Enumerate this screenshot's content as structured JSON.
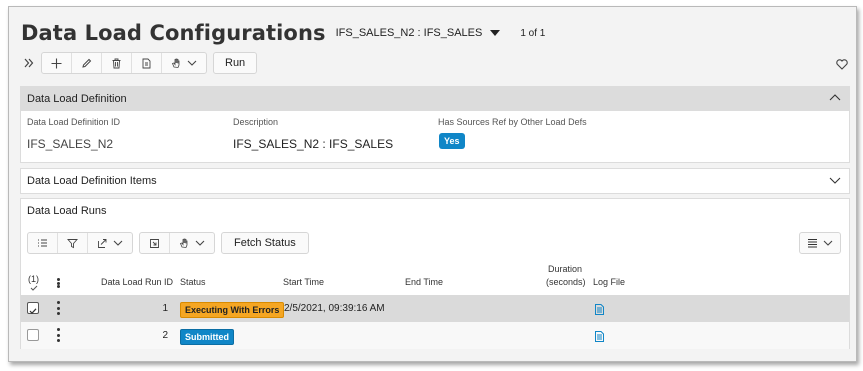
{
  "header": {
    "title": "Data Load Configurations",
    "record_selector": "IFS_SALES_N2 : IFS_SALES",
    "record_count": "1 of 1"
  },
  "toolbar": {
    "run_label": "Run",
    "icons": [
      "expand-icon",
      "add-icon",
      "edit-icon",
      "delete-icon",
      "duplicate-icon",
      "hand-icon",
      "chevron-down-icon"
    ]
  },
  "definition": {
    "title": "Data Load Definition",
    "fields": {
      "id_label": "Data Load Definition ID",
      "id_value": "IFS_SALES_N2",
      "desc_label": "Description",
      "desc_value": "IFS_SALES_N2 : IFS_SALES",
      "shared_label": "Has Sources Ref by Other Load Defs",
      "shared_value": "Yes"
    }
  },
  "items": {
    "title": "Data Load Definition Items"
  },
  "runs": {
    "title": "Data Load Runs",
    "fetch_label": "Fetch Status",
    "selected_count": "(1)",
    "columns": {
      "run_id": "Data Load Run ID",
      "status": "Status",
      "start": "Start Time",
      "end": "End Time",
      "duration_1": "Duration",
      "duration_2": "(seconds)",
      "log": "Log File"
    },
    "rows": [
      {
        "id": "1",
        "status": "Executing With Errors",
        "status_kind": "warning",
        "start": "2/5/2021, 09:39:16 AM",
        "end": "",
        "duration": "",
        "selected": true
      },
      {
        "id": "2",
        "status": "Submitted",
        "status_kind": "info",
        "start": "",
        "end": "",
        "duration": "",
        "selected": false
      }
    ]
  },
  "colors": {
    "badge_blue": "#1086c7",
    "badge_orange": "#f5a623",
    "header_gray": "#dcdcdc"
  }
}
